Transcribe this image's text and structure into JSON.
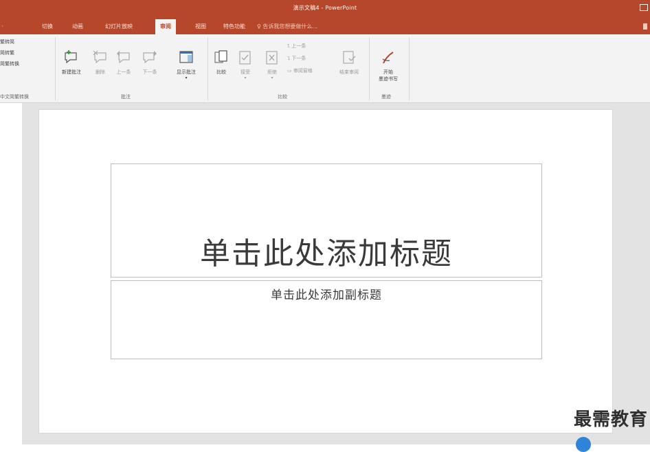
{
  "window": {
    "title": "演示文稿4 - PowerPoint"
  },
  "tabs": [
    {
      "label": "切换",
      "active": false
    },
    {
      "label": "动画",
      "active": false
    },
    {
      "label": "幻灯片放映",
      "active": false
    },
    {
      "label": "审阅",
      "active": true
    },
    {
      "label": "视图",
      "active": false
    },
    {
      "label": "特色功能",
      "active": false
    }
  ],
  "tell_me": {
    "placeholder": "告诉我您想要做什么..."
  },
  "ribbon": {
    "chinese_convert": {
      "items": [
        "繁转简",
        "简转繁",
        "简繁转换"
      ],
      "group_label": "中文简繁转换"
    },
    "comments": {
      "new_comment": "新建批注",
      "delete": "删除",
      "previous": "上一条",
      "next": "下一条",
      "show_comments": "显示批注",
      "group_label": "批注"
    },
    "compare": {
      "compare": "比较",
      "accept": "接受",
      "reject": "拒绝",
      "previous": "上一条",
      "next": "下一条",
      "reviewing_pane": "审阅窗格",
      "end_review": "结束审阅",
      "group_label": "比较"
    },
    "ink": {
      "start_inking": "开始\n墨迹书写",
      "start_line1": "开始",
      "start_line2": "墨迹书写",
      "group_label": "墨迹"
    }
  },
  "slide": {
    "title_placeholder": "单击此处添加标题",
    "subtitle_placeholder": "单击此处添加副标题"
  },
  "watermark": "最需教育",
  "colors": {
    "accent": "#b7472a",
    "ribbon_bg": "#f3f3f3",
    "workspace_bg": "#e3e3e3"
  }
}
